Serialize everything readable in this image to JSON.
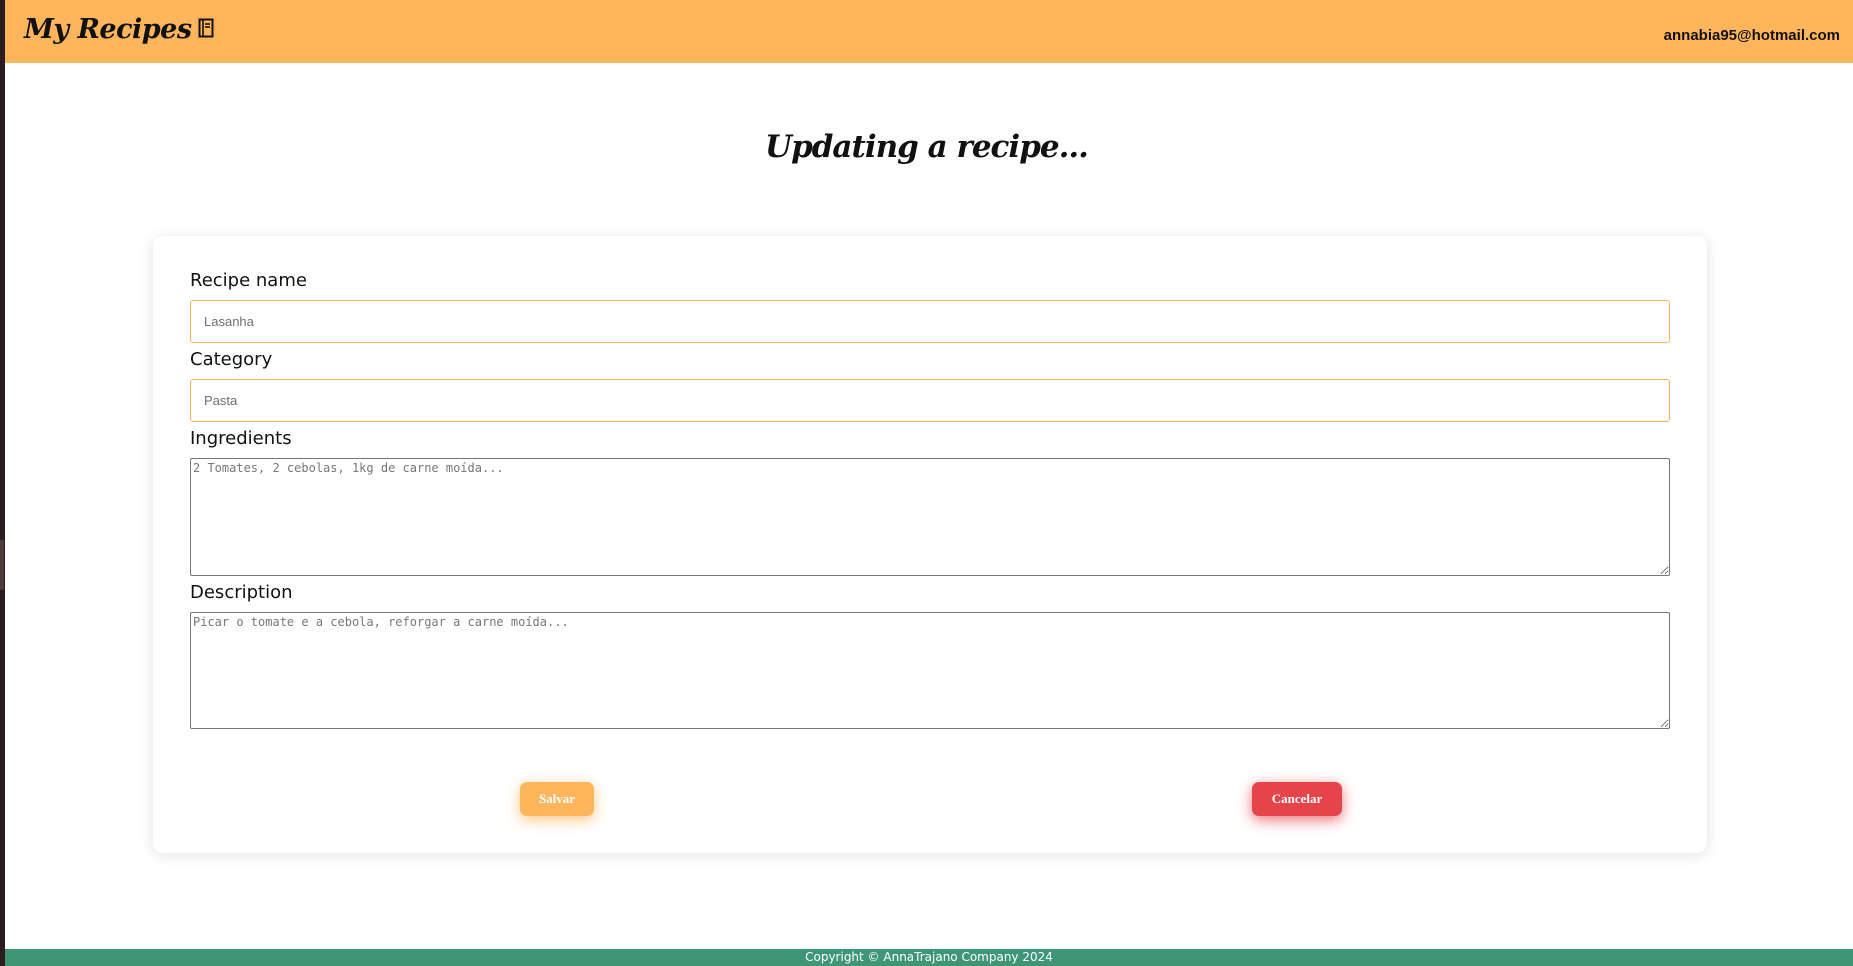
{
  "header": {
    "app_title": "My Recipes",
    "logo_icon": "book-icon",
    "user_email": "annabia95@hotmail.com",
    "background_color": "#ffb55c"
  },
  "page": {
    "title": "Updating a recipe..."
  },
  "form": {
    "recipe_name": {
      "label": "Recipe name",
      "value": "",
      "placeholder": "Lasanha"
    },
    "category": {
      "label": "Category",
      "value": "",
      "placeholder": "Pasta"
    },
    "ingredients": {
      "label": "Ingredients",
      "value": "",
      "placeholder": "2 Tomates, 2 cebolas, 1kg de carne moída..."
    },
    "description": {
      "label": "Description",
      "value": "",
      "placeholder": "Picar o tomate e a cebola, reforgar a carne moída..."
    },
    "save_label": "Salvar",
    "cancel_label": "Cancelar",
    "save_color": "#ffb55c",
    "cancel_color": "#e5444a"
  },
  "footer": {
    "copyright": "Copyright © AnnaTrajano Company 2024",
    "background_color": "#3e9677"
  }
}
